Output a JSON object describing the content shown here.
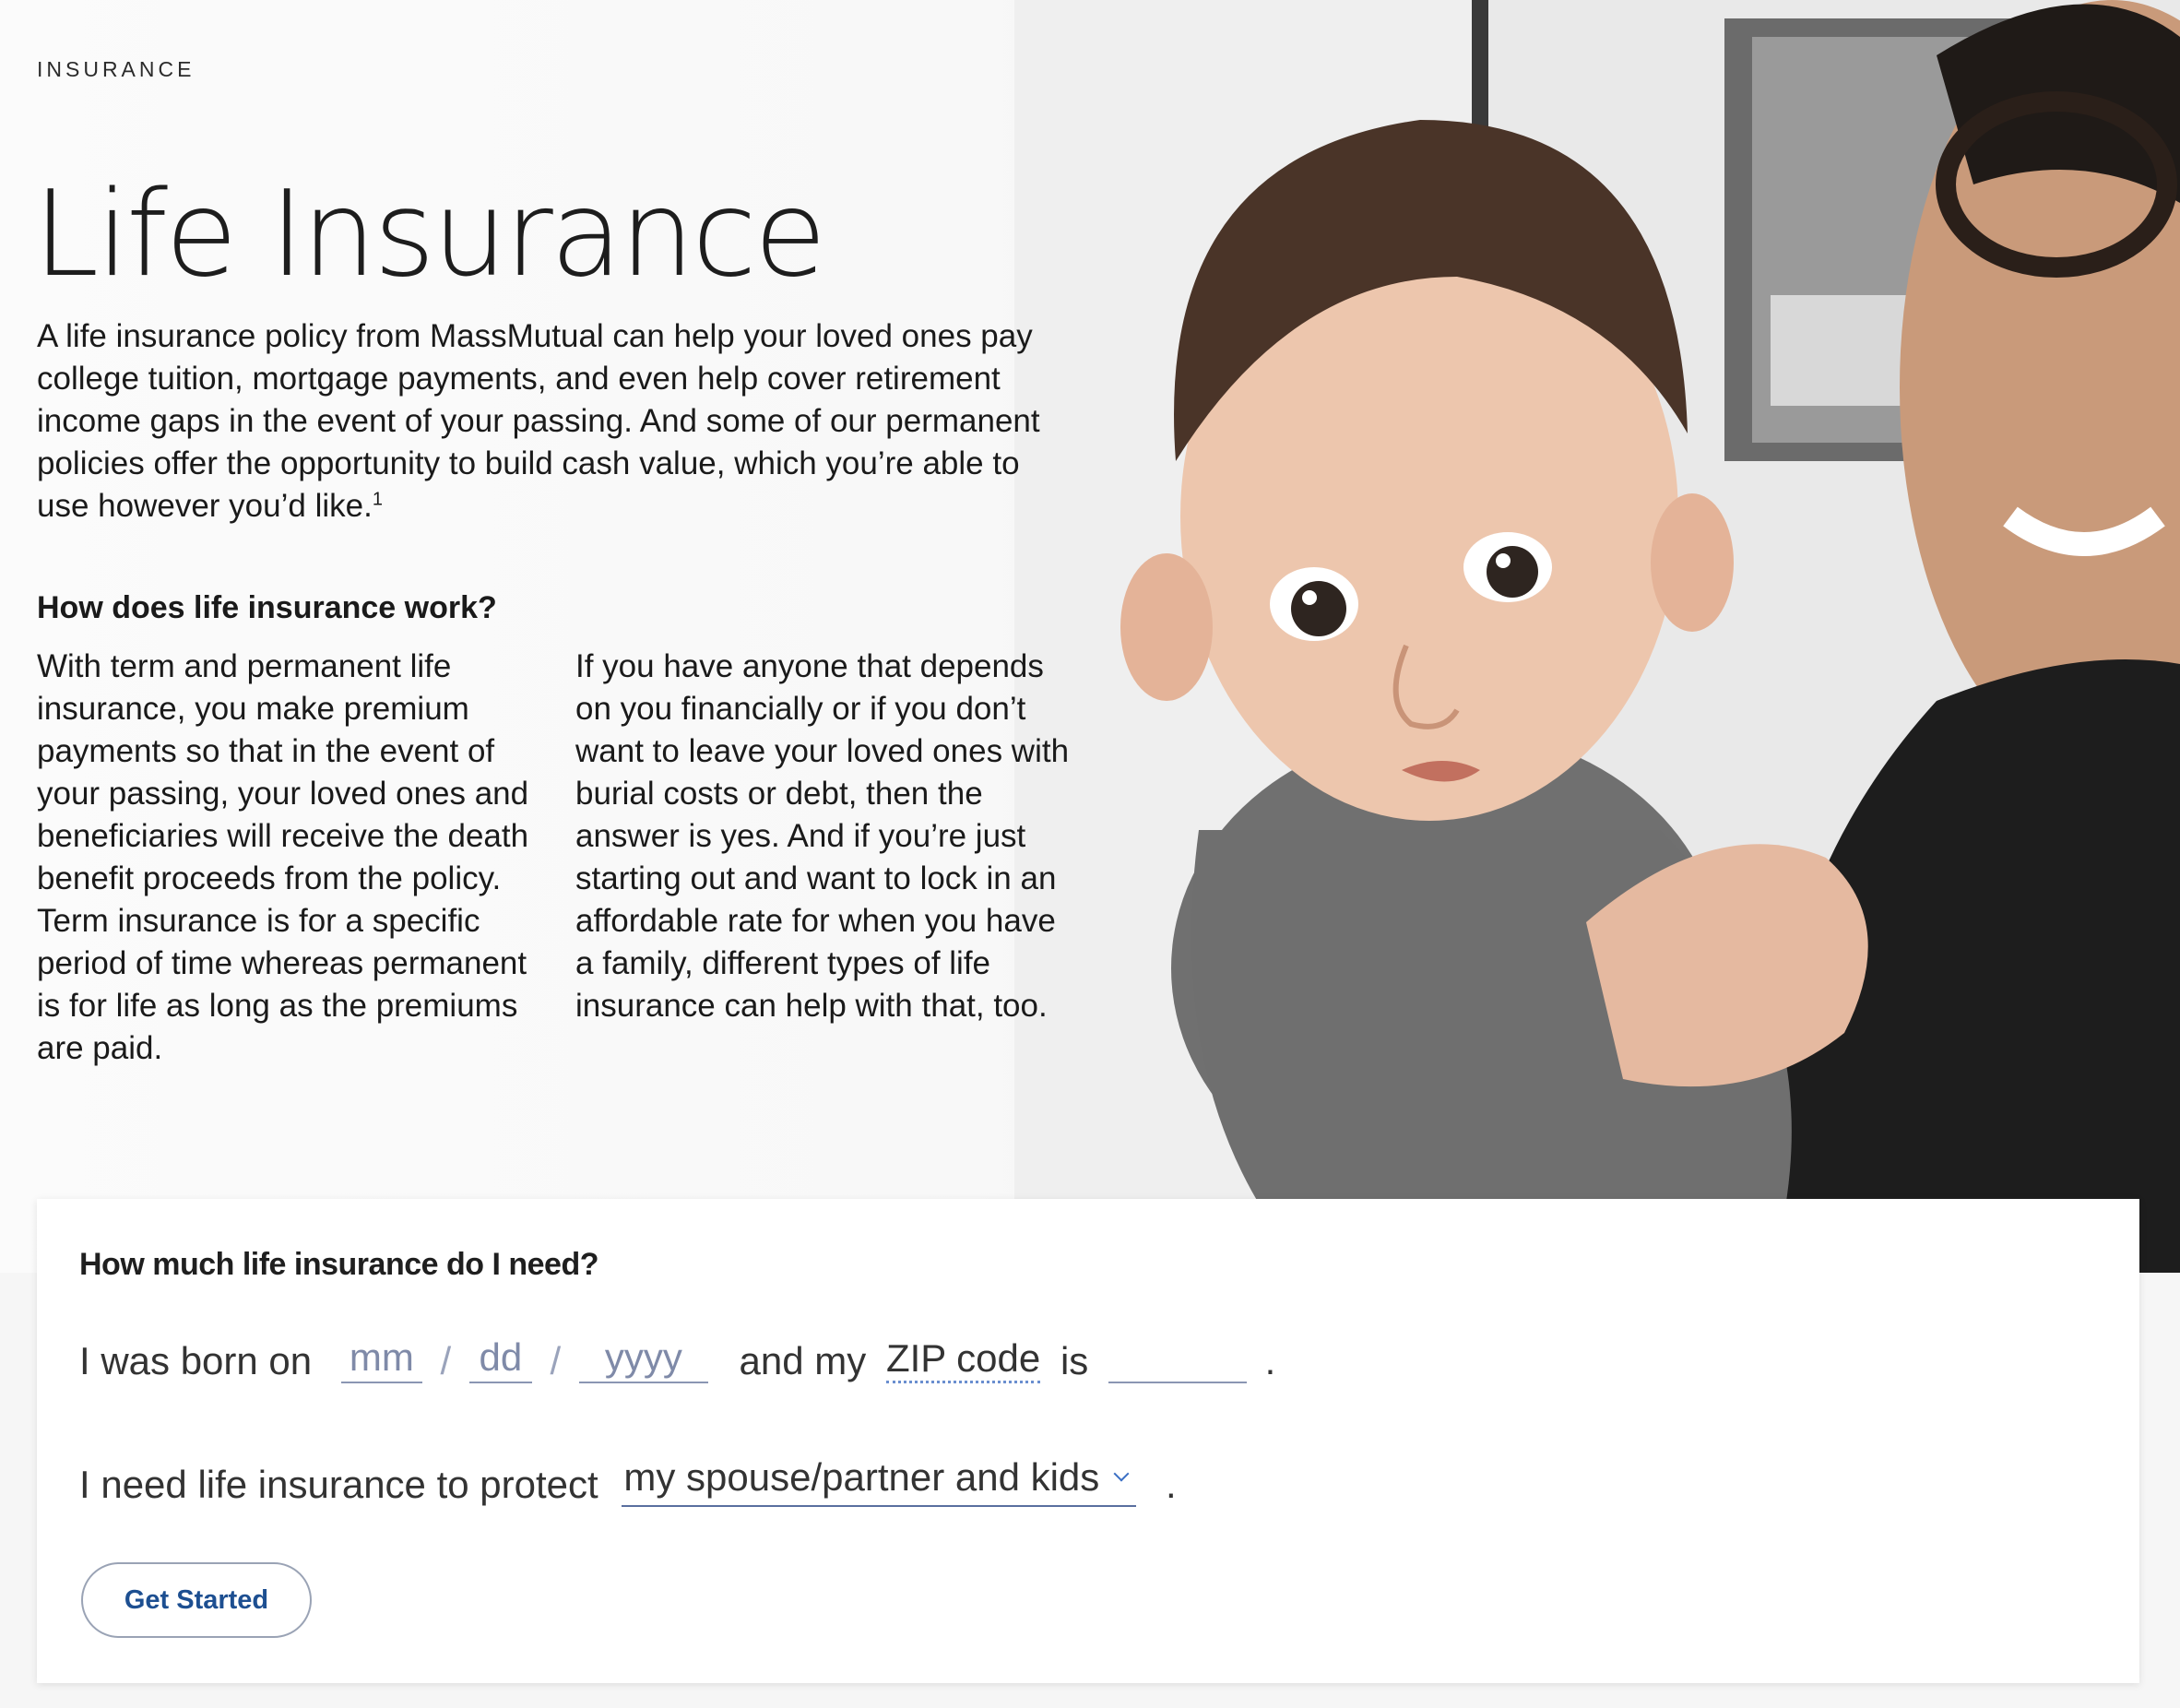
{
  "hero": {
    "eyebrow": "INSURANCE",
    "title": "Life Insurance",
    "intro": "A life insurance policy from MassMutual can help your loved ones pay college tuition, mortgage payments, and even help cover retirement income gaps in the event of your passing. And some of our permanent policies offer the opportunity to build cash value, which you’re able to use however you’d like.",
    "intro_footnote": "1",
    "subhead": "How does life insurance work?",
    "col_left": "With term and permanent life insurance, you make premium payments so that in the event of your passing, your loved ones and beneficiaries will receive the death benefit proceeds from the policy. Term insurance is for a specific period of time whereas permanent is for life as long as the premiums are paid.",
    "col_right": "If you have anyone that depends on you financially or if you don’t want to leave your loved ones with burial costs or debt, then the answer is yes. And if you’re just starting out and want to lock in an affordable rate for when you have a family, different types of life insurance can help with that, too."
  },
  "calculator": {
    "title": "How much life insurance do I need?",
    "born_label": "I was born on",
    "month_placeholder": "mm",
    "day_placeholder": "dd",
    "year_placeholder": "yyyy",
    "separator": "/",
    "zip_label_prefix": "and my",
    "zip_term": "ZIP code",
    "zip_label_suffix": "is",
    "period": ".",
    "protect_label": "I need life insurance to protect",
    "protect_selected": "my spouse/partner and kids",
    "cta": "Get Started"
  },
  "colors": {
    "link_blue": "#1d4f91",
    "placeholder": "#7f8aa8",
    "accent_dotted": "#6a8fcf"
  }
}
